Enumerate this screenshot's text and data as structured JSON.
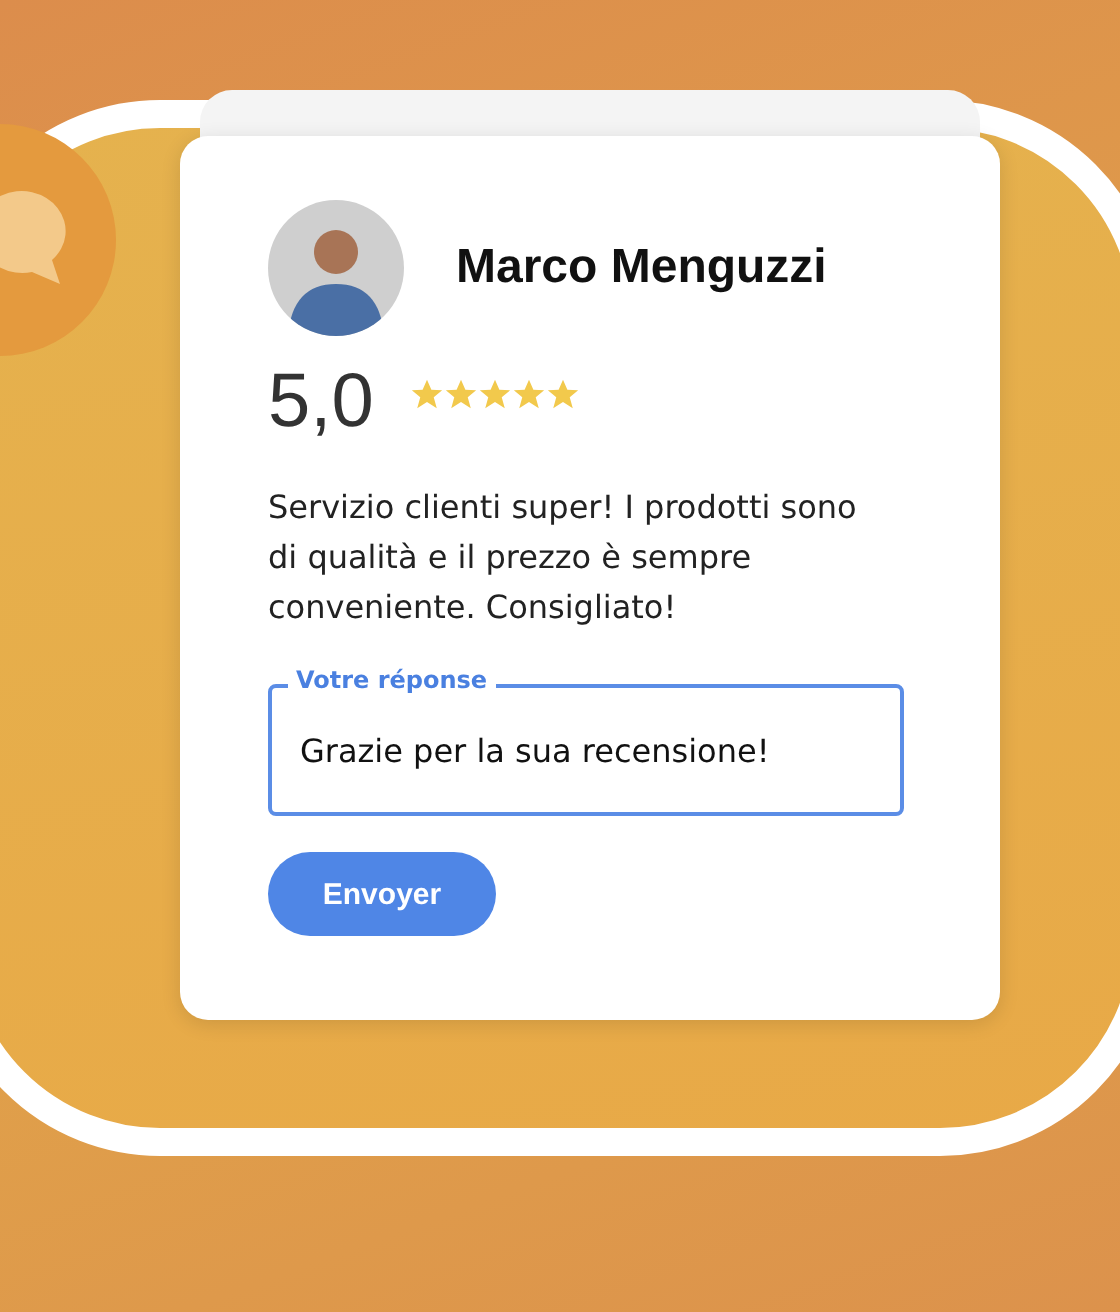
{
  "reviewer": {
    "name": "Marco Menguzzi"
  },
  "review": {
    "score": "5,0",
    "stars": 5,
    "text": "Servizio clienti super! I prodotti sono di qualità e il prezzo è sempre conveniente. Consigliato!"
  },
  "reply": {
    "label": "Votre réponse",
    "value": "Grazie per la sua recensione!"
  },
  "buttons": [
    {
      "label": "Envoyer"
    }
  ]
}
